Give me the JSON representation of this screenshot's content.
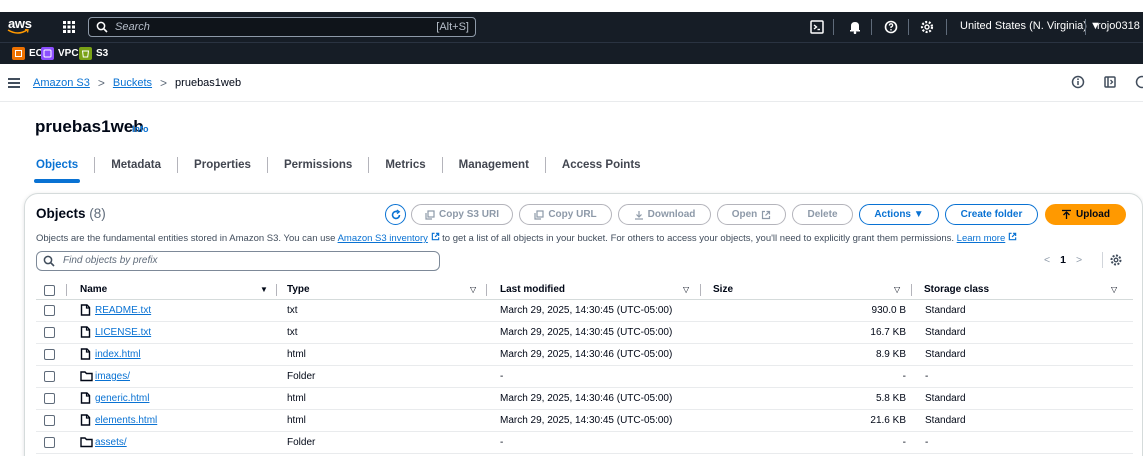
{
  "topnav": {
    "logo_text": "aws",
    "search_placeholder": "Search",
    "search_shortcut": "[Alt+S]",
    "region": "United States (N. Virginia) ▼",
    "user": "rojo0318 ▼"
  },
  "favorites": [
    {
      "label": "EC2",
      "color": "#ed7100"
    },
    {
      "label": "VPC",
      "color": "#8c4fff"
    },
    {
      "label": "S3",
      "color": "#7aa116"
    }
  ],
  "breadcrumb": {
    "items": [
      "Amazon S3",
      "Buckets"
    ],
    "current": "pruebas1web",
    "separator": ">"
  },
  "page": {
    "title": "pruebas1web",
    "info": "Info"
  },
  "tabs": [
    "Objects",
    "Metadata",
    "Properties",
    "Permissions",
    "Metrics",
    "Management",
    "Access Points"
  ],
  "objects": {
    "title": "Objects",
    "count": "(8)",
    "desc_prefix": "Objects are the fundamental entities stored in Amazon S3. You can use ",
    "desc_link": "Amazon S3 inventory",
    "desc_middle": " to get a list of all objects in your bucket. For others to access your objects, you'll need to explicitly grant them permissions. ",
    "desc_learn": "Learn more",
    "filter_placeholder": "Find objects by prefix",
    "buttons": {
      "copy_s3_uri": "Copy S3 URI",
      "copy_url": "Copy URL",
      "download": "Download",
      "open": "Open",
      "delete": "Delete",
      "actions": "Actions ▼",
      "create_folder": "Create folder",
      "upload": "Upload"
    },
    "pager": {
      "prev": "<",
      "page": "1",
      "next": ">"
    },
    "columns": {
      "name": "Name",
      "type": "Type",
      "last_modified": "Last modified",
      "size": "Size",
      "storage_class": "Storage class"
    },
    "rows": [
      {
        "name": "README.txt",
        "icon": "file-icon",
        "type": "txt",
        "modified": "March 29, 2025, 14:30:45 (UTC-05:00)",
        "size": "930.0 B",
        "storage": "Standard"
      },
      {
        "name": "LICENSE.txt",
        "icon": "file-icon",
        "type": "txt",
        "modified": "March 29, 2025, 14:30:45 (UTC-05:00)",
        "size": "16.7 KB",
        "storage": "Standard"
      },
      {
        "name": "index.html",
        "icon": "file-icon",
        "type": "html",
        "modified": "March 29, 2025, 14:30:46 (UTC-05:00)",
        "size": "8.9 KB",
        "storage": "Standard"
      },
      {
        "name": "images/",
        "icon": "folder-icon",
        "type": "Folder",
        "modified": "-",
        "size": "-",
        "storage": "-"
      },
      {
        "name": "generic.html",
        "icon": "file-icon",
        "type": "html",
        "modified": "March 29, 2025, 14:30:46 (UTC-05:00)",
        "size": "5.8 KB",
        "storage": "Standard"
      },
      {
        "name": "elements.html",
        "icon": "file-icon",
        "type": "html",
        "modified": "March 29, 2025, 14:30:45 (UTC-05:00)",
        "size": "21.6 KB",
        "storage": "Standard"
      },
      {
        "name": "assets/",
        "icon": "folder-icon",
        "type": "Folder",
        "modified": "-",
        "size": "-",
        "storage": "-"
      }
    ]
  }
}
